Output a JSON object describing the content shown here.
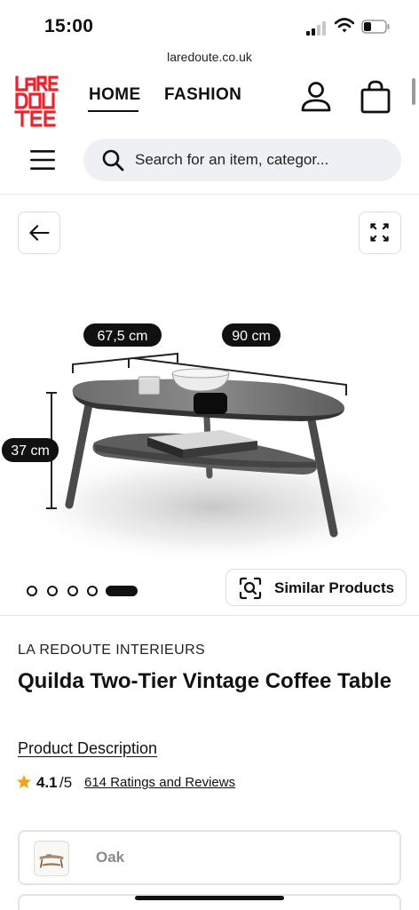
{
  "status_bar": {
    "time": "15:00"
  },
  "browser": {
    "url": "laredoute.co.uk"
  },
  "header": {
    "logo_text": "LA REDOUTE",
    "nav": [
      {
        "label": "HOME",
        "active": true
      },
      {
        "label": "FASHION",
        "active": false
      }
    ]
  },
  "search": {
    "placeholder": "Search for an item, categor..."
  },
  "gallery": {
    "dimension_labels": {
      "depth": "67,5 cm",
      "width": "90 cm",
      "height": "37 cm"
    },
    "image_count": 5,
    "active_index": 5
  },
  "similar_products": {
    "label": "Similar Products"
  },
  "product": {
    "brand": "LA REDOUTE INTERIEURS",
    "title": "Quilda Two-Tier Vintage Coffee Table",
    "description_link": "Product Description",
    "rating": {
      "score": "4.1",
      "out_of": "/5",
      "reviews_label": "614 Ratings and Reviews"
    },
    "variants": [
      {
        "label": "Oak"
      }
    ]
  },
  "colors": {
    "logo_red": "#e8242e",
    "star": "#f0a51a",
    "search_bg": "#eef0f3"
  },
  "icons": {
    "user": "user-icon",
    "bag": "shopping-bag-icon",
    "menu": "hamburger-menu-icon",
    "search": "search-icon",
    "back": "arrow-left-icon",
    "expand": "expand-icon",
    "similar": "visual-search-icon",
    "star": "star-icon"
  }
}
